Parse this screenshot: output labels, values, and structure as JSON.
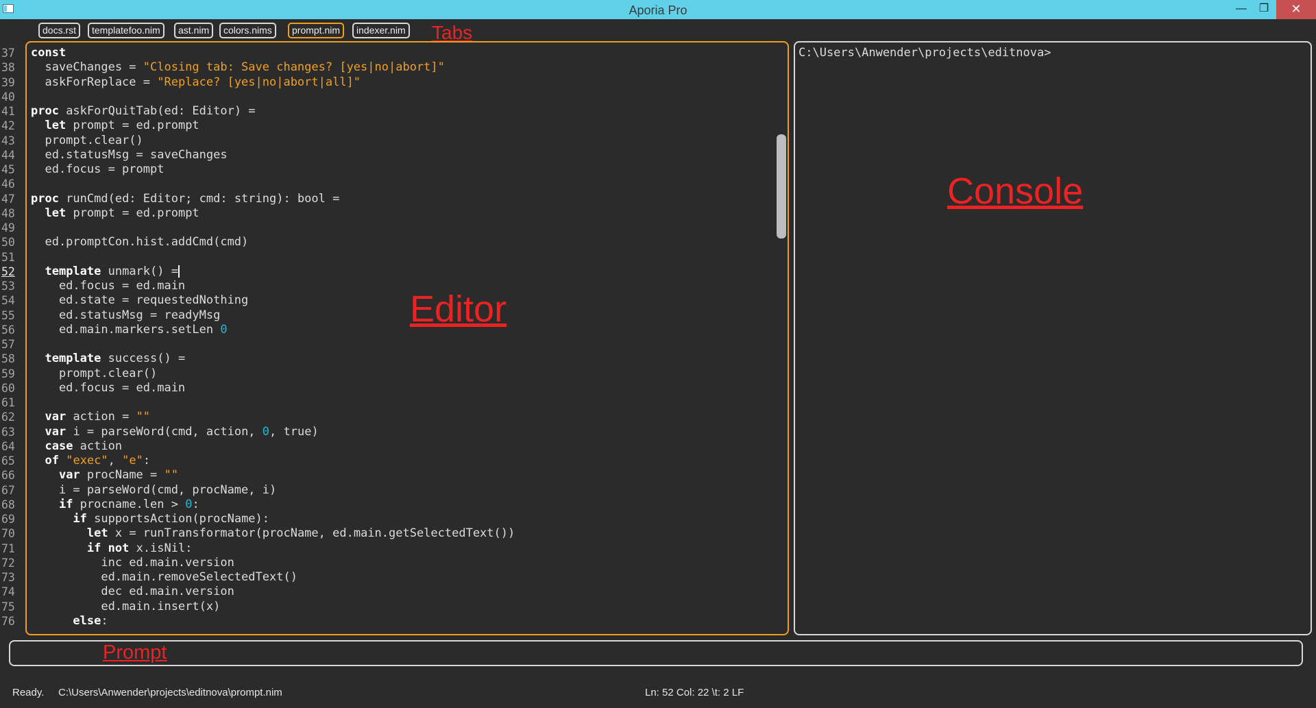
{
  "window": {
    "title": "Aporia Pro",
    "minimize": "—",
    "maximize": "❐",
    "close": "✕"
  },
  "tabs": [
    {
      "label": "docs.rst",
      "active": false
    },
    {
      "label": "templatefoo.nim",
      "active": false
    },
    {
      "label": "ast.nim",
      "active": false
    },
    {
      "label": "colors.nims",
      "active": false
    },
    {
      "label": "prompt.nim",
      "active": true
    },
    {
      "label": "indexer.nim",
      "active": false
    }
  ],
  "annotations": {
    "tabs": "Tabs",
    "editor": "Editor",
    "console": "Console",
    "prompt": "Prompt"
  },
  "editor": {
    "current_line": 52,
    "lines": [
      {
        "n": "37",
        "text": "const"
      },
      {
        "n": "38",
        "text": "  saveChanges = \"Closing tab: Save changes? [yes|no|abort]\""
      },
      {
        "n": "39",
        "text": "  askForReplace = \"Replace? [yes|no|abort|all]\""
      },
      {
        "n": "40",
        "text": ""
      },
      {
        "n": "41",
        "text": "proc askForQuitTab(ed: Editor) ="
      },
      {
        "n": "42",
        "text": "  let prompt = ed.prompt"
      },
      {
        "n": "43",
        "text": "  prompt.clear()"
      },
      {
        "n": "44",
        "text": "  ed.statusMsg = saveChanges"
      },
      {
        "n": "45",
        "text": "  ed.focus = prompt"
      },
      {
        "n": "46",
        "text": ""
      },
      {
        "n": "47",
        "text": "proc runCmd(ed: Editor; cmd: string): bool ="
      },
      {
        "n": "48",
        "text": "  let prompt = ed.prompt"
      },
      {
        "n": "49",
        "text": ""
      },
      {
        "n": "50",
        "text": "  ed.promptCon.hist.addCmd(cmd)"
      },
      {
        "n": "51",
        "text": ""
      },
      {
        "n": "52",
        "text": "  template unmark() ="
      },
      {
        "n": "53",
        "text": "    ed.focus = ed.main"
      },
      {
        "n": "54",
        "text": "    ed.state = requestedNothing"
      },
      {
        "n": "55",
        "text": "    ed.statusMsg = readyMsg"
      },
      {
        "n": "56",
        "text": "    ed.main.markers.setLen 0"
      },
      {
        "n": "57",
        "text": ""
      },
      {
        "n": "58",
        "text": "  template success() ="
      },
      {
        "n": "59",
        "text": "    prompt.clear()"
      },
      {
        "n": "60",
        "text": "    ed.focus = ed.main"
      },
      {
        "n": "61",
        "text": ""
      },
      {
        "n": "62",
        "text": "  var action = \"\""
      },
      {
        "n": "63",
        "text": "  var i = parseWord(cmd, action, 0, true)"
      },
      {
        "n": "64",
        "text": "  case action"
      },
      {
        "n": "65",
        "text": "  of \"exec\", \"e\":"
      },
      {
        "n": "66",
        "text": "    var procName = \"\""
      },
      {
        "n": "67",
        "text": "    i = parseWord(cmd, procName, i)"
      },
      {
        "n": "68",
        "text": "    if procname.len > 0:"
      },
      {
        "n": "69",
        "text": "      if supportsAction(procName):"
      },
      {
        "n": "70",
        "text": "        let x = runTransformator(procName, ed.main.getSelectedText())"
      },
      {
        "n": "71",
        "text": "        if not x.isNil:"
      },
      {
        "n": "72",
        "text": "          inc ed.main.version"
      },
      {
        "n": "73",
        "text": "          ed.main.removeSelectedText()"
      },
      {
        "n": "74",
        "text": "          dec ed.main.version"
      },
      {
        "n": "75",
        "text": "          ed.main.insert(x)"
      },
      {
        "n": "76",
        "text": "      else:"
      }
    ]
  },
  "console": {
    "prompt_line": "C:\\Users\\Anwender\\projects\\editnova>"
  },
  "prompt": {
    "value": ""
  },
  "status": {
    "state": "Ready.",
    "path": "C:\\Users\\Anwender\\projects\\editnova\\prompt.nim",
    "position": "Ln: 52 Col: 22 \\t: 2 LF"
  },
  "colors": {
    "accent": "#f0a01e",
    "titlebar": "#5fd2ea",
    "annotation": "#ee2222",
    "number": "#20b8d4"
  }
}
